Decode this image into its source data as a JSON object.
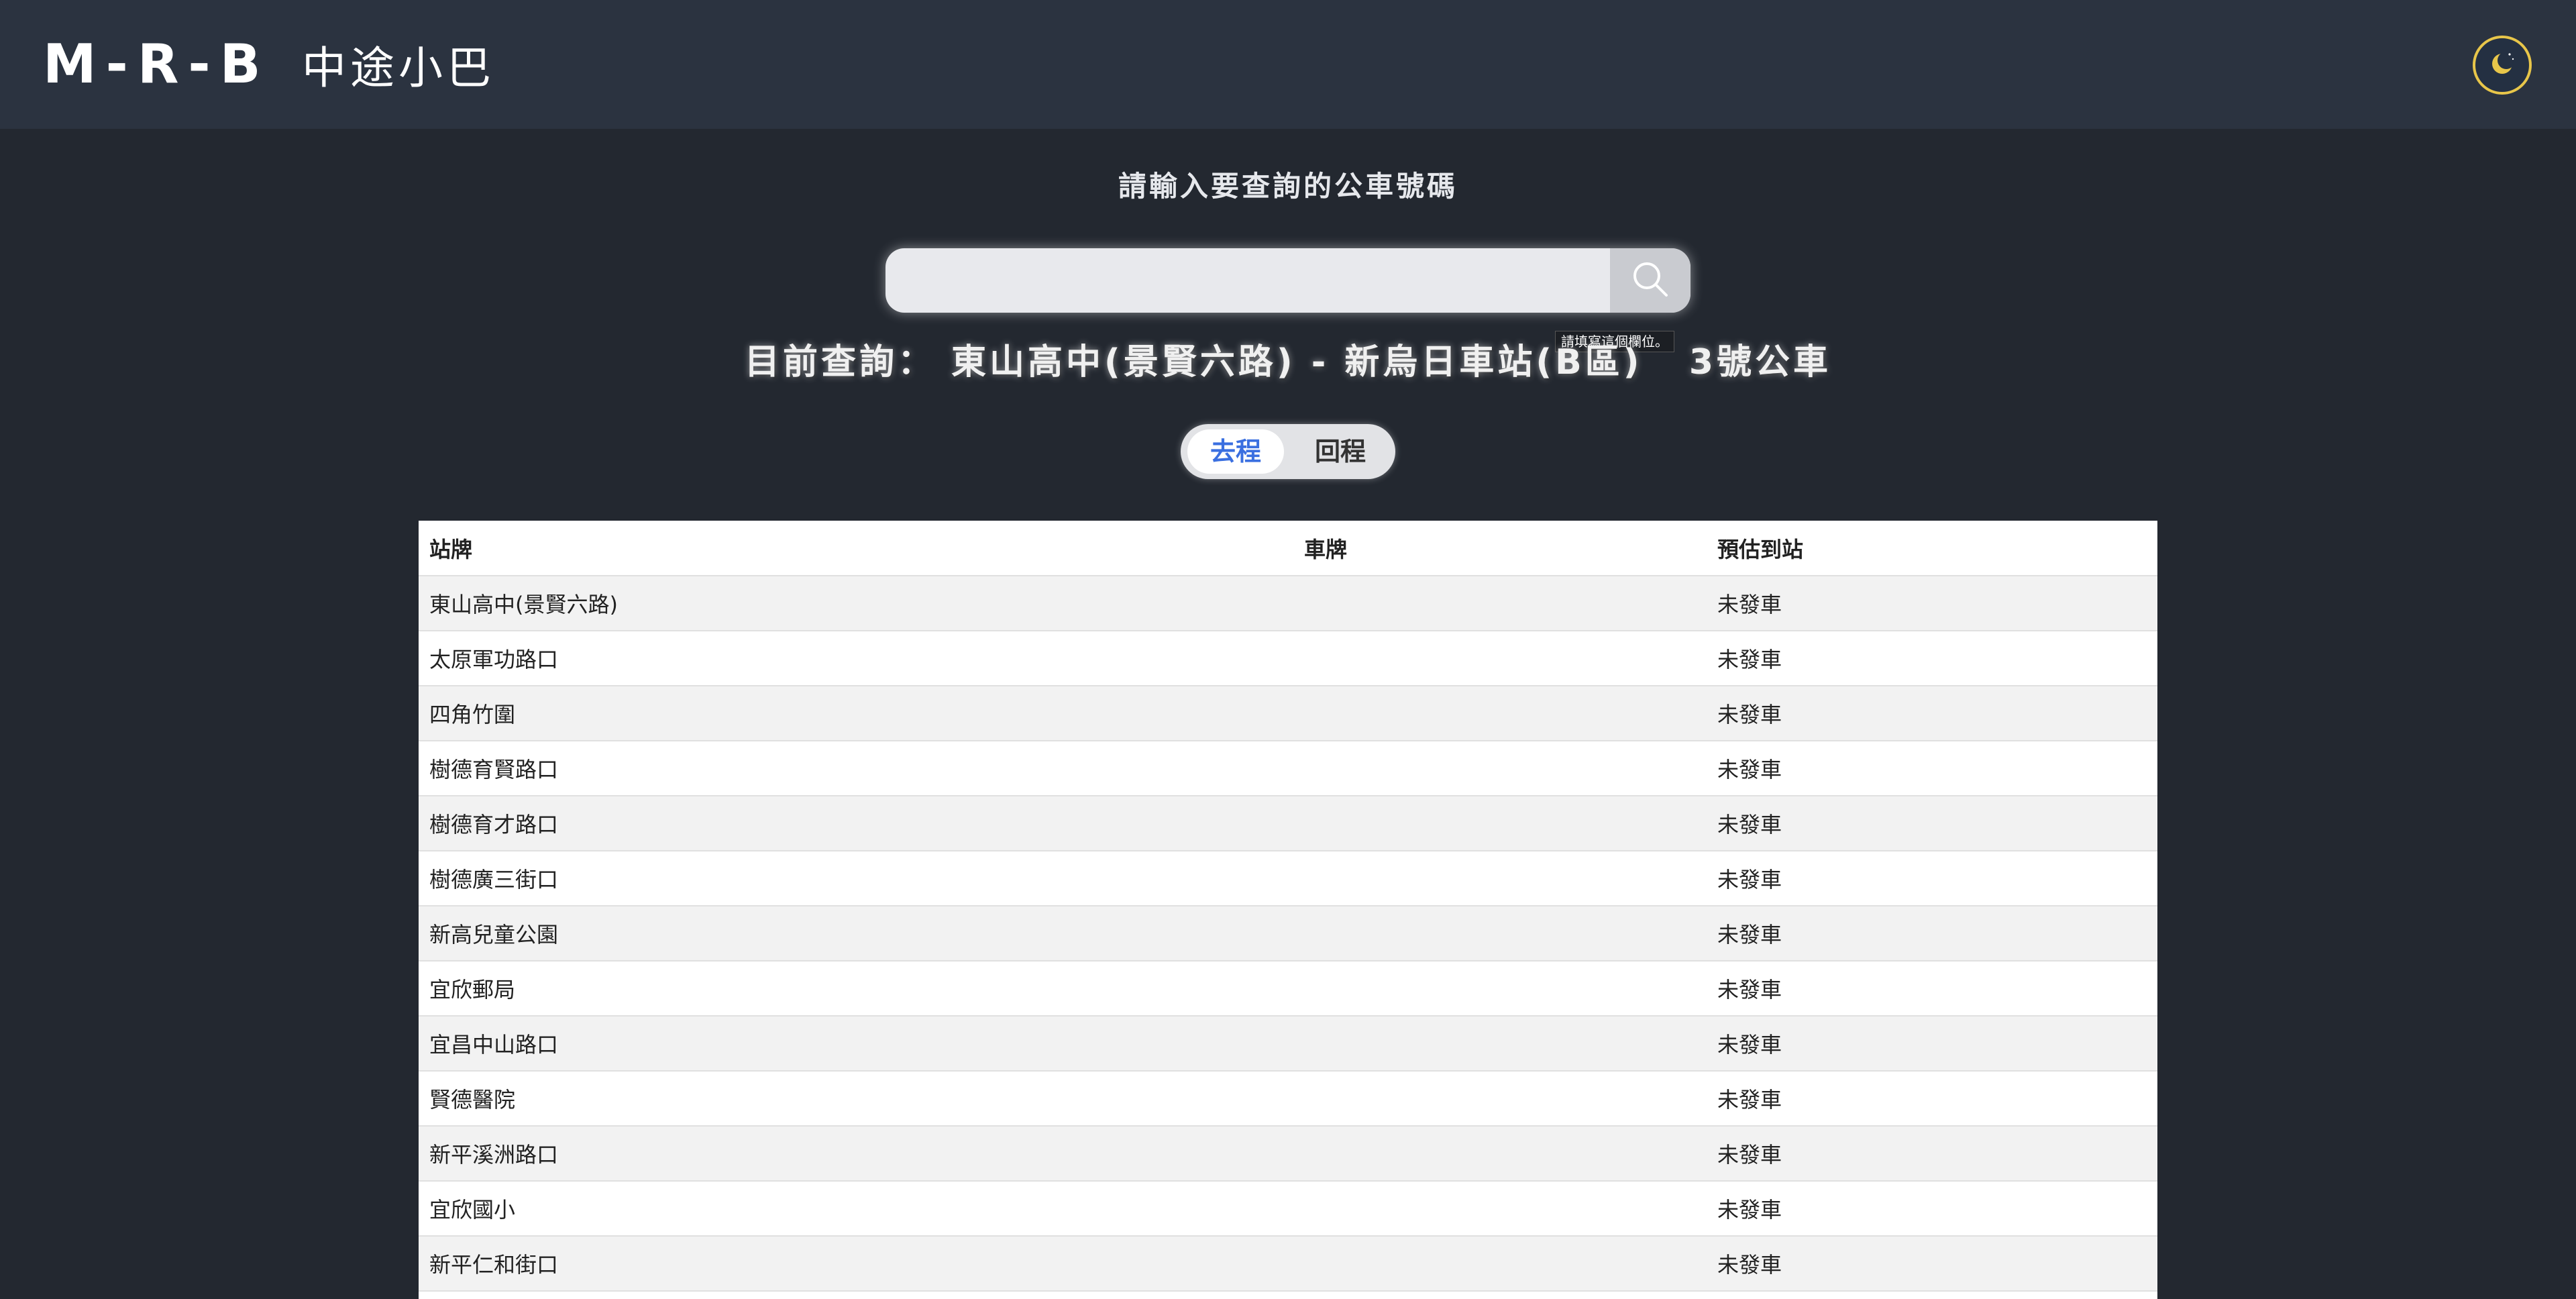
{
  "header": {
    "brand": "M-R-B",
    "subtitle": "中途小巴",
    "theme_toggle_icon": "moon-icon",
    "accent_color": "#e8c64a"
  },
  "search": {
    "prompt": "請輸入要查詢的公車號碼",
    "value": "",
    "placeholder": "",
    "button_icon": "search-icon",
    "validation_tooltip": "請填寫這個欄位。"
  },
  "current_query": {
    "text": "目前查詢： 東山高中(景賢六路) - 新烏日車站(B區)   3號公車"
  },
  "direction_toggle": {
    "outbound": "去程",
    "return": "回程",
    "active": "outbound",
    "active_color": "#3a6fe0"
  },
  "table": {
    "headers": [
      "站牌",
      "車牌",
      "預估到站"
    ],
    "rows": [
      {
        "stop": "東山高中(景賢六路)",
        "plate": "",
        "eta": "未發車"
      },
      {
        "stop": "太原軍功路口",
        "plate": "",
        "eta": "未發車"
      },
      {
        "stop": "四角竹圍",
        "plate": "",
        "eta": "未發車"
      },
      {
        "stop": "樹德育賢路口",
        "plate": "",
        "eta": "未發車"
      },
      {
        "stop": "樹德育才路口",
        "plate": "",
        "eta": "未發車"
      },
      {
        "stop": "樹德廣三街口",
        "plate": "",
        "eta": "未發車"
      },
      {
        "stop": "新高兒童公園",
        "plate": "",
        "eta": "未發車"
      },
      {
        "stop": "宜欣郵局",
        "plate": "",
        "eta": "未發車"
      },
      {
        "stop": "宜昌中山路口",
        "plate": "",
        "eta": "未發車"
      },
      {
        "stop": "賢德醫院",
        "plate": "",
        "eta": "未發車"
      },
      {
        "stop": "新平溪洲路口",
        "plate": "",
        "eta": "未發車"
      },
      {
        "stop": "宜欣國小",
        "plate": "",
        "eta": "未發車"
      },
      {
        "stop": "新平仁和街口",
        "plate": "",
        "eta": "未發車"
      },
      {
        "stop": "",
        "plate": "",
        "eta": ""
      }
    ]
  }
}
